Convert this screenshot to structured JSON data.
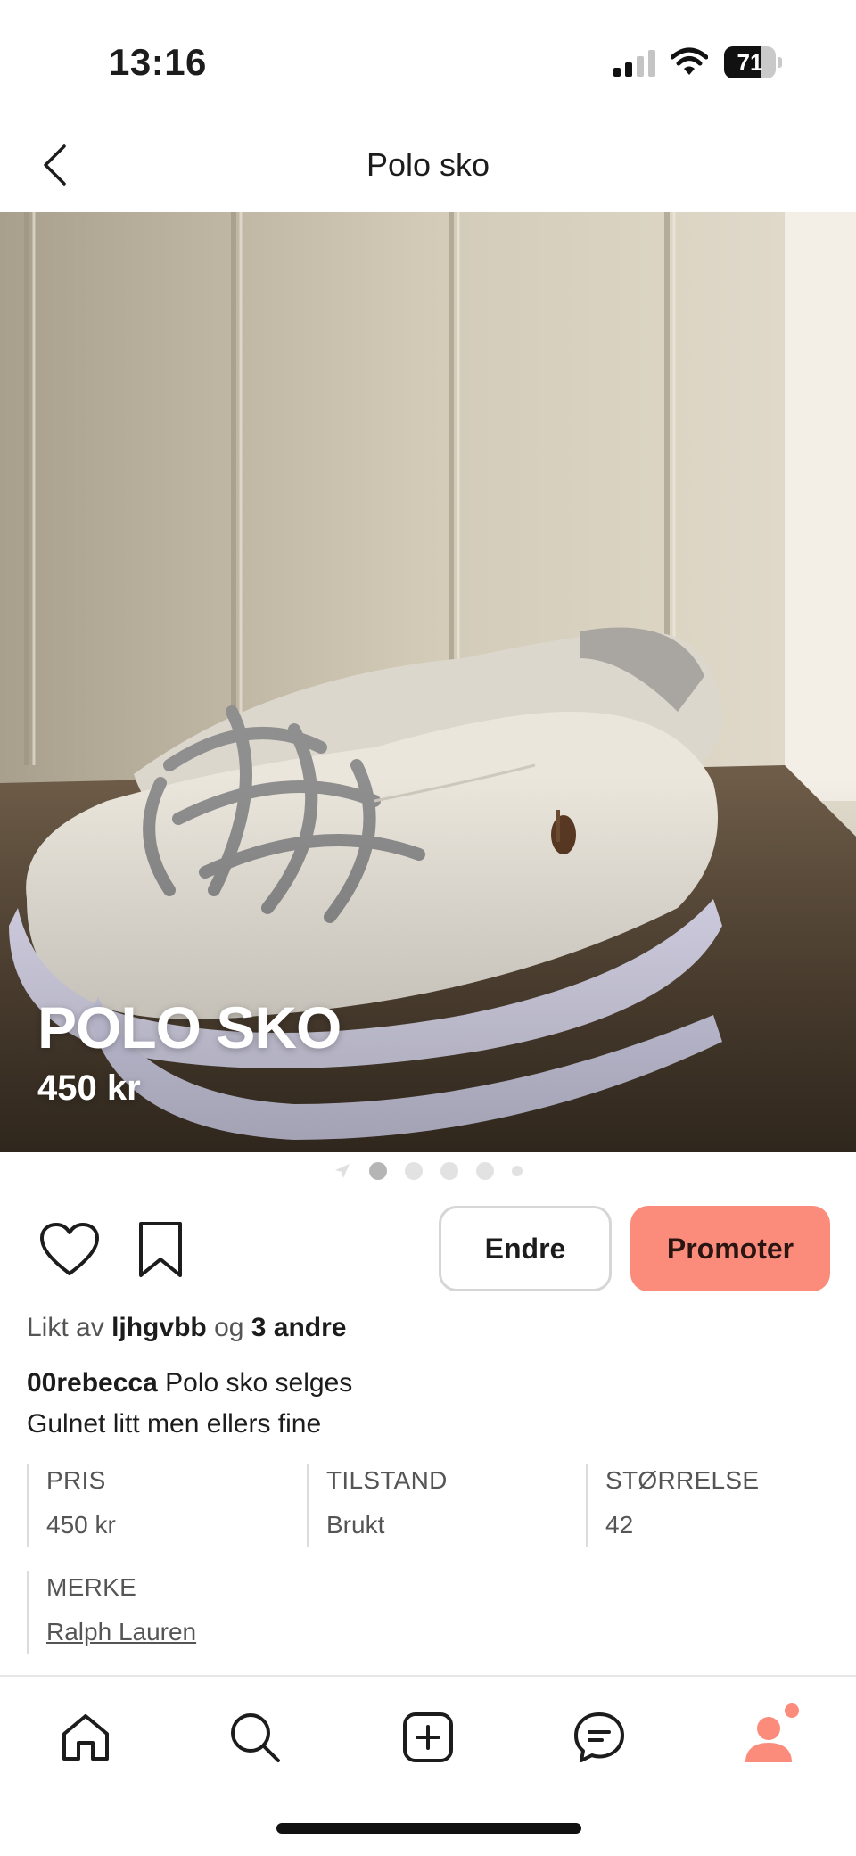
{
  "status_bar": {
    "time": "13:16",
    "battery": "71",
    "battery_level": 0.71,
    "icons": [
      "signal-icon",
      "wifi-icon",
      "battery-icon"
    ]
  },
  "header": {
    "title": "Polo sko",
    "back_icon": "chevron-left-icon"
  },
  "product": {
    "overlay_title": "POLO SKO",
    "overlay_price": "450 kr"
  },
  "carousel": {
    "total_dots": 5,
    "active_index": 0
  },
  "actions": {
    "like_icon": "heart-icon",
    "save_icon": "bookmark-icon",
    "edit_label": "Endre",
    "promote_label": "Promoter"
  },
  "liked_by": {
    "prefix": "Likt av",
    "user": "ljhgvbb",
    "joiner": "og",
    "others": "3 andre"
  },
  "caption": {
    "username": "00rebecca",
    "line1": "Polo sko selges",
    "line2": "Gulnet litt men ellers fine"
  },
  "details": [
    {
      "label": "PRIS",
      "value": "450 kr"
    },
    {
      "label": "TILSTAND",
      "value": "Brukt"
    },
    {
      "label": "STØRRELSE",
      "value": "42"
    },
    {
      "label": "MERKE",
      "value": "Ralph Lauren"
    }
  ],
  "tab_bar": {
    "items": [
      "home-icon",
      "search-icon",
      "add-icon",
      "messages-icon",
      "profile-icon"
    ],
    "accent": "#fb8c7c"
  },
  "colors": {
    "accent": "#fb8c7c",
    "text": "#1c1c1c",
    "muted": "#555555"
  }
}
